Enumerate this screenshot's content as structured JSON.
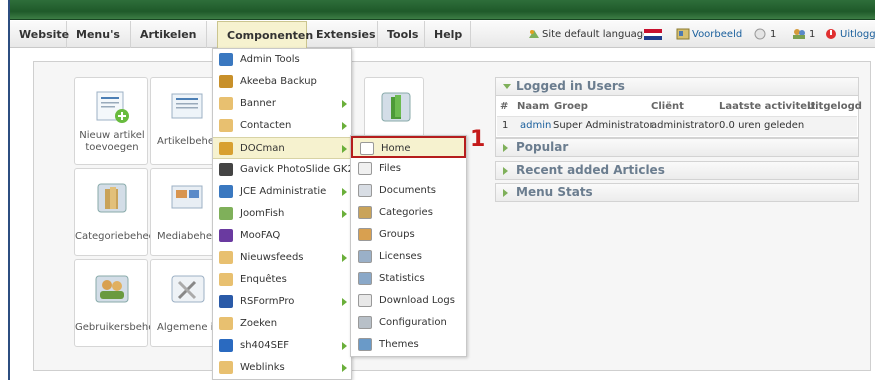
{
  "menu": {
    "items": [
      {
        "label": "Website"
      },
      {
        "label": "Menu's"
      },
      {
        "label": "Artikelen"
      },
      {
        "label": "Componenten"
      },
      {
        "label": "Extensies"
      },
      {
        "label": "Tools"
      },
      {
        "label": "Help"
      }
    ],
    "active": "Componenten"
  },
  "status": {
    "site_language_label": "Site default language:",
    "preview_label": "Voorbeeld",
    "messages_count": "1",
    "users_count": "1",
    "logout_label": "Uitloggen"
  },
  "tiles": [
    {
      "label": "Nieuw artikel toevoegen",
      "icon": "new-article-icon"
    },
    {
      "label": "Artikelbeheer",
      "icon": "article-manager-icon"
    },
    {
      "label": "Categoriebeheer",
      "icon": "category-manager-icon"
    },
    {
      "label": "Mediabeheer",
      "icon": "media-manager-icon"
    },
    {
      "label": "Gebruikersbeheer",
      "icon": "user-manager-icon"
    },
    {
      "label": "Algemene instellingen",
      "icon": "global-config-icon"
    }
  ],
  "components_menu": [
    {
      "label": "Admin Tools",
      "icon": "shield-icon",
      "submenu": false
    },
    {
      "label": "Akeeba Backup",
      "icon": "akeeba-icon",
      "submenu": false
    },
    {
      "label": "Banner",
      "icon": "component-icon",
      "submenu": true
    },
    {
      "label": "Contacten",
      "icon": "component-icon",
      "submenu": true
    },
    {
      "label": "DOCman",
      "icon": "docman-icon",
      "submenu": true
    },
    {
      "label": "Gavick PhotoSlide GK2",
      "icon": "gavick-icon",
      "submenu": false
    },
    {
      "label": "JCE Administratie",
      "icon": "jce-icon",
      "submenu": true
    },
    {
      "label": "JoomFish",
      "icon": "joomfish-icon",
      "submenu": true
    },
    {
      "label": "MooFAQ",
      "icon": "moofaq-icon",
      "submenu": false
    },
    {
      "label": "Nieuwsfeeds",
      "icon": "component-icon",
      "submenu": true
    },
    {
      "label": "Enquêtes",
      "icon": "component-icon",
      "submenu": false
    },
    {
      "label": "RSFormPro",
      "icon": "rsform-icon",
      "submenu": true
    },
    {
      "label": "Zoeken",
      "icon": "component-icon",
      "submenu": false
    },
    {
      "label": "sh404SEF",
      "icon": "sh404sef-icon",
      "submenu": true
    },
    {
      "label": "Weblinks",
      "icon": "component-icon",
      "submenu": true
    }
  ],
  "docman_submenu": [
    {
      "label": "Home",
      "icon": "home-icon"
    },
    {
      "label": "Files",
      "icon": "files-icon"
    },
    {
      "label": "Documents",
      "icon": "documents-icon"
    },
    {
      "label": "Categories",
      "icon": "categories-icon"
    },
    {
      "label": "Groups",
      "icon": "groups-icon"
    },
    {
      "label": "Licenses",
      "icon": "licenses-icon"
    },
    {
      "label": "Statistics",
      "icon": "statistics-icon"
    },
    {
      "label": "Download Logs",
      "icon": "download-logs-icon"
    },
    {
      "label": "Configuration",
      "icon": "configuration-icon"
    },
    {
      "label": "Themes",
      "icon": "themes-icon"
    }
  ],
  "callout": "1",
  "logged_in": {
    "title": "Logged in Users",
    "columns": [
      "#",
      "Naam",
      "Groep",
      "Cliënt",
      "Laatste activiteit",
      "Uitgelogd"
    ],
    "rows": [
      {
        "num": "1",
        "name": "admin",
        "group": "Super Administrator",
        "client": "administrator",
        "activity": "0.0 uren geleden"
      }
    ]
  },
  "sections": [
    "Popular",
    "Recent added Articles",
    "Menu Stats"
  ],
  "colors": {
    "accent_green": "#1f5a2a",
    "highlight": "#f6f2cf",
    "callout_red": "#c41a1a",
    "link_blue": "#1a5f9c"
  }
}
